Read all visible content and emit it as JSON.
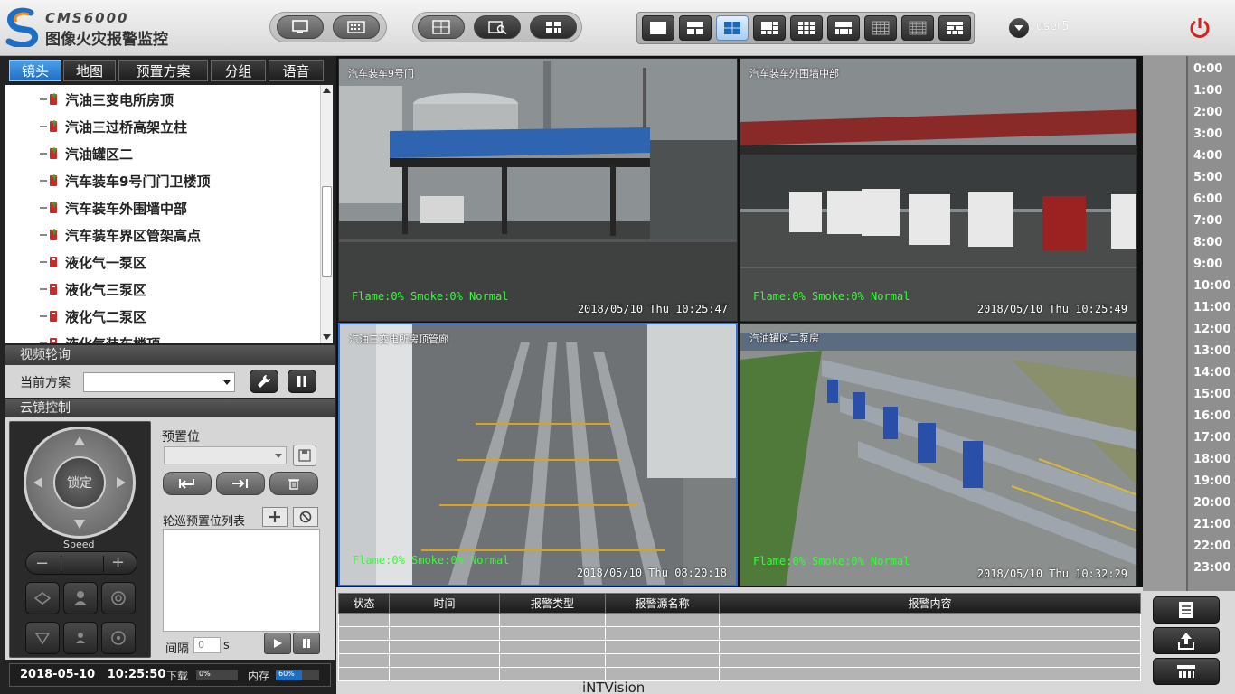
{
  "app": {
    "brand_code": "CMS6000",
    "title": "图像火灾报警监控",
    "user": "user5"
  },
  "tabs": [
    "镜头",
    "地图",
    "预置方案",
    "分组",
    "语音"
  ],
  "camera_tree": [
    "汽油三变电所房顶",
    "汽油三过桥高架立柱",
    "汽油罐区二",
    "汽车装车9号门门卫楼顶",
    "汽车装车外围墙中部",
    "汽车装车界区管架高点",
    "液化气一泵区",
    "液化气三泵区",
    "液化气二泵区",
    "液化气装车楼顶"
  ],
  "tour": {
    "section_label": "视频轮询",
    "current_label": "当前方案",
    "current_value": ""
  },
  "ptz": {
    "section_label": "云镜控制",
    "lock_label": "锁定",
    "speed_label": "Speed",
    "preset_label": "预置位",
    "preset_value": "",
    "patrol_list_label": "轮巡预置位列表",
    "interval_label": "间隔",
    "interval_value": "0",
    "interval_unit": "s"
  },
  "status": {
    "datetime": "2018-05-10   10:25:50",
    "download_label": "下载",
    "download_value": "0%",
    "download_fraction": 0.0,
    "memory_label": "内存",
    "memory_value": "60%",
    "memory_fraction": 0.6
  },
  "videos": [
    {
      "title": "汽车装车9号门",
      "status": "Flame:0% Smoke:0% Normal",
      "time": "2018/05/10 Thu 10:25:47"
    },
    {
      "title": "汽车装车外围墙中部",
      "status": "Flame:0% Smoke:0% Normal",
      "time": "2018/05/10 Thu 10:25:49"
    },
    {
      "title": "汽油三变电所房顶管廊",
      "status": "Flame:0% Smoke:0% Normal",
      "time": "2018/05/10 Thu 08:20:18"
    },
    {
      "title": "汽油罐区二泵房",
      "status": "Flame:0% Smoke:0% Normal",
      "time": "2018/05/10 Thu 10:32:29"
    }
  ],
  "timeline_hours": [
    "0:00",
    "1:00",
    "2:00",
    "3:00",
    "4:00",
    "5:00",
    "6:00",
    "7:00",
    "8:00",
    "9:00",
    "10:00",
    "11:00",
    "12:00",
    "13:00",
    "14:00",
    "15:00",
    "16:00",
    "17:00",
    "18:00",
    "19:00",
    "20:00",
    "21:00",
    "22:00",
    "23:00"
  ],
  "alarm_table": {
    "headers": [
      "状态",
      "时间",
      "报警类型",
      "报警源名称",
      "报警内容"
    ],
    "rows": 5
  },
  "footer_brand": "iNTVision",
  "colors": {
    "accent": "#1f6fc1",
    "osd_green": "#33ff33",
    "power": "#d22222"
  }
}
